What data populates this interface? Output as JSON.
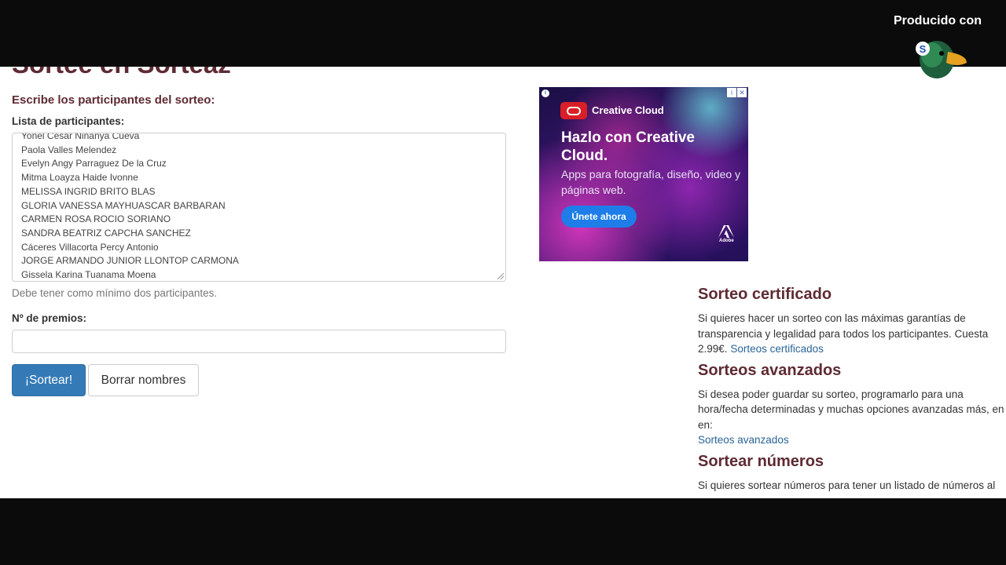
{
  "title": "Sortee en Sorteaz",
  "form": {
    "heading": "Escribe los participantes del sorteo:",
    "list_label": "Lista de participantes:",
    "participants": [
      "Yonel Cesar Ninanya Cueva",
      "Paola Valles Melendez",
      "Evelyn Angy Parraguez De la Cruz",
      "Mitma Loayza Haide Ivonne",
      "MELISSA INGRID BRITO BLAS",
      "GLORIA VANESSA MAYHUASCAR BARBARAN",
      "CARMEN ROSA ROCIO SORIANO",
      "SANDRA BEATRIZ CAPCHA SANCHEZ",
      "Cáceres Villacorta Percy Antonio",
      "JORGE ARMANDO JUNIOR LLONTOP CARMONA",
      "Gissela Karina Tuanama Moena"
    ],
    "help_text": "Debe tener como mínimo dos participantes.",
    "prizes_label": "Nº de premios:",
    "prizes_value": "",
    "draw_button": "¡Sortear!",
    "clear_button": "Borrar nombres"
  },
  "ad": {
    "brand": "Creative Cloud",
    "headline": "Hazlo con Creative Cloud.",
    "body": "Apps para fotografía, diseño, video y páginas web.",
    "cta": "Únete ahora",
    "adobe_label": "Adobe",
    "close_glyph": "✕",
    "info_glyph": "i"
  },
  "sidebar": {
    "certified": {
      "heading": "Sorteo certificado",
      "text": "Si quieres hacer un sorteo con las máximas garantías de transparencia y legalidad para todos los participantes. Cuesta 2.99€.",
      "link": "Sorteos certificados"
    },
    "advanced": {
      "heading": "Sorteos avanzados",
      "text": "Si desea poder guardar su sorteo, programarlo para una hora/fecha determinadas y muchas opciones avanzadas más, en en:",
      "link": "Sorteos avanzados"
    },
    "numbers": {
      "heading": "Sortear números",
      "text": "Si quieres sortear números para tener un listado de números al"
    }
  },
  "overlay": {
    "produced_with": "Producido con",
    "streamyard": "StreamYard",
    "logo_letter": "S"
  },
  "colors": {
    "heading": "#5e2a33",
    "primary_button": "#337ab7",
    "link": "#2a6496",
    "letterbox": "#0b0b0b"
  }
}
